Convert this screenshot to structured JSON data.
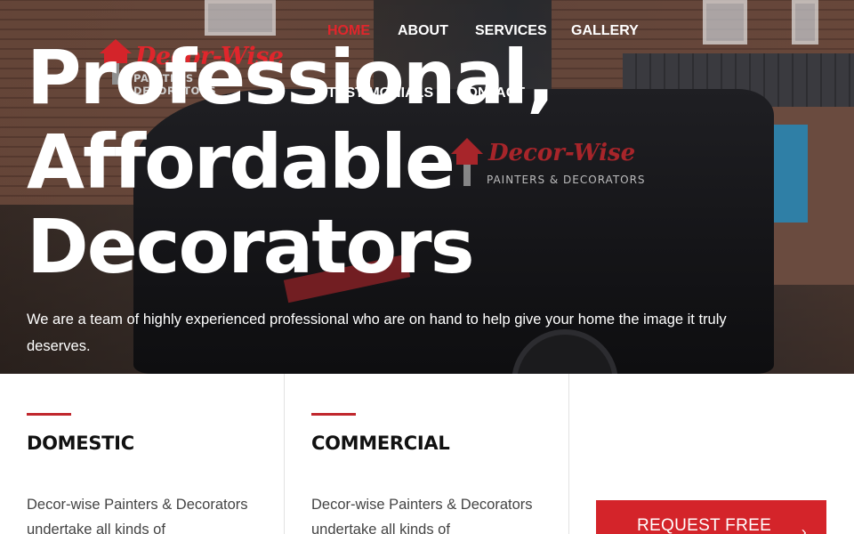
{
  "brand": {
    "name": "Decor-Wise",
    "tagline": "PAINTERS & DECORATORS",
    "accent_color": "#e0262c"
  },
  "nav": {
    "items": [
      {
        "label": "HOME",
        "active": true
      },
      {
        "label": "ABOUT",
        "active": false
      },
      {
        "label": "SERVICES",
        "active": false
      },
      {
        "label": "GALLERY",
        "active": false
      },
      {
        "label": "TESTIMONIALS",
        "active": false
      },
      {
        "label": "CONTACT",
        "active": false
      }
    ]
  },
  "hero": {
    "headline_lines": [
      "Professional,",
      "Affordable",
      "Decorators"
    ],
    "subtext": "We are a team of highly experienced professional who are on hand to help give your home the image it truly deserves.",
    "van_logo_name": "Decor-Wise",
    "van_logo_tagline": "PAINTERS & DECORATORS"
  },
  "cards": [
    {
      "title": "DOMESTIC",
      "text": "Decor-wise Painters & Decorators undertake all kinds of"
    },
    {
      "title": "COMMERCIAL",
      "text": "Decor-wise Painters & Decorators undertake all kinds of"
    }
  ],
  "cta": {
    "label": "REQUEST FREE",
    "icon": "chevron-right-icon"
  }
}
